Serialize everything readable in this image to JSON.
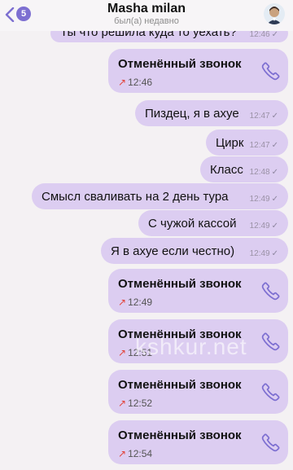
{
  "header": {
    "back_count": "5",
    "name": "Masha milan",
    "status": "был(а) недавно"
  },
  "messages": [
    {
      "text": "Ты что решила куда то уехать?",
      "time": "12:46"
    },
    {
      "call_title": "Отменённый звонок",
      "time": "12:46"
    },
    {
      "text": "Пиздец, я в ахуе",
      "time": "12:47"
    },
    {
      "text": "Цирк",
      "time": "12:47"
    },
    {
      "text": "Класс",
      "time": "12:48"
    },
    {
      "text": "Смысл сваливать на 2 день тура",
      "time": "12:49"
    },
    {
      "text": "С чужой кассой",
      "time": "12:49"
    },
    {
      "text": "Я в ахуе если честно)",
      "time": "12:49"
    },
    {
      "call_title": "Отменённый звонок",
      "time": "12:49"
    },
    {
      "call_title": "Отменённый звонок",
      "time": "12:51"
    },
    {
      "call_title": "Отменённый звонок",
      "time": "12:52"
    },
    {
      "call_title": "Отменённый звонок",
      "time": "12:54"
    }
  ],
  "icons": {
    "back": "chevron-left-icon",
    "call": "phone-icon",
    "missed": "arrow-up-right-icon",
    "check": "check-icon"
  },
  "watermark": "kshkur.net",
  "colors": {
    "bubble": "#dccdf1",
    "accent": "#7d6fd1",
    "missed_arrow": "#e2453c",
    "background": "#f4f1f3"
  }
}
